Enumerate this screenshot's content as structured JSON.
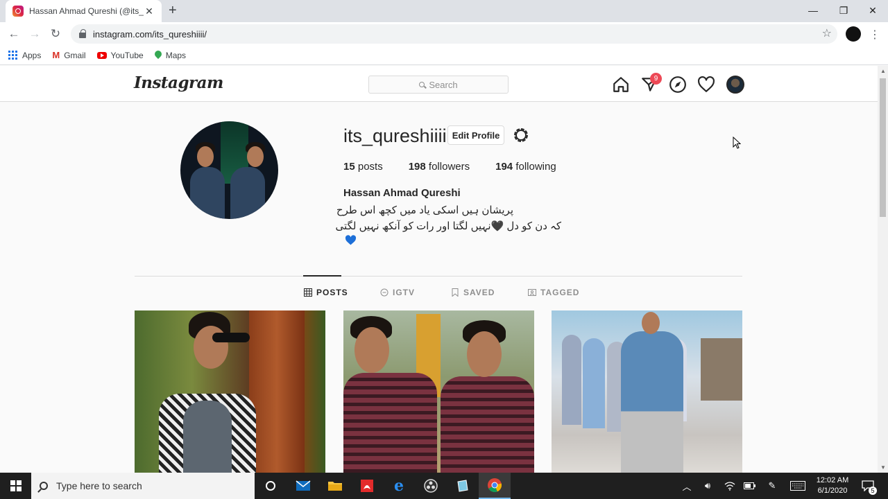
{
  "browser": {
    "tab_title": "Hassan Ahmad Qureshi (@its_qu",
    "url": "instagram.com/its_qureshiiii/",
    "bookmarks": [
      {
        "label": "Apps",
        "icon": "apps-icon"
      },
      {
        "label": "Gmail",
        "icon": "gmail-icon"
      },
      {
        "label": "YouTube",
        "icon": "youtube-icon"
      },
      {
        "label": "Maps",
        "icon": "maps-icon"
      }
    ]
  },
  "instagram": {
    "logo": "Instagram",
    "search_placeholder": "Search",
    "notification_count": "9",
    "username": "its_qureshiiii",
    "edit_profile_label": "Edit Profile",
    "stats": {
      "posts_count": "15",
      "posts_label": "posts",
      "followers_count": "198",
      "followers_label": "followers",
      "following_count": "194",
      "following_label": "following"
    },
    "full_name": "Hassan Ahmad Qureshi",
    "bio_line1": "پریشان ہیں اسکی یاد میں کچھ اس طرح",
    "bio_line2": "کہ دن کو دل 🖤نہیں لگتا اور رات کو آنکھ نہیں لگتی",
    "tabs": [
      {
        "label": "POSTS",
        "icon": "grid-icon",
        "active": true
      },
      {
        "label": "IGTV",
        "icon": "igtv-icon",
        "active": false
      },
      {
        "label": "SAVED",
        "icon": "bookmark-icon",
        "active": false
      },
      {
        "label": "TAGGED",
        "icon": "tag-icon",
        "active": false
      }
    ],
    "colors": {
      "badge": "#ed4956",
      "border": "#dbdbdb",
      "text": "#262626",
      "muted": "#8e8e8e"
    }
  },
  "taskbar": {
    "search_placeholder": "Type here to search",
    "time": "12:02 AM",
    "date": "6/1/2020",
    "notification_count": "5"
  }
}
